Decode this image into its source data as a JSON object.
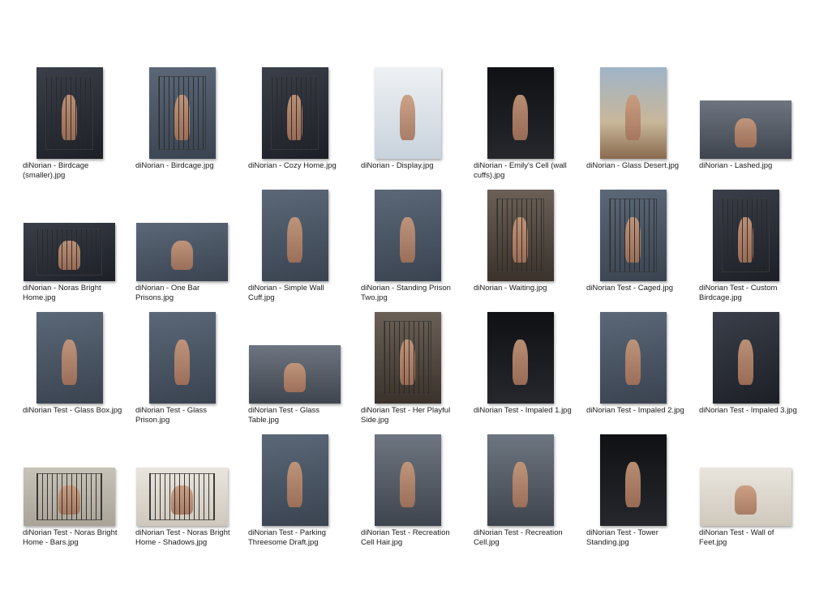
{
  "files": [
    {
      "name": "diNorian - Birdcage (smaller).jpg",
      "shape": "tall",
      "tone": "dark",
      "bars": true
    },
    {
      "name": "diNorian - Birdcage.jpg",
      "shape": "tall",
      "tone": "slate",
      "bars": true
    },
    {
      "name": "diNorian - Cozy Home.jpg",
      "shape": "tall",
      "tone": "dark",
      "bars": true
    },
    {
      "name": "diNorian - Display.jpg",
      "shape": "tall",
      "tone": "light",
      "bars": false
    },
    {
      "name": "diNorian - Emily's Cell (wall cuffs).jpg",
      "shape": "tall",
      "tone": "black",
      "bars": false
    },
    {
      "name": "diNorian - Glass Desert.jpg",
      "shape": "tall",
      "tone": "sky",
      "bars": false
    },
    {
      "name": "diNorian - Lashed.jpg",
      "shape": "wide",
      "tone": "grey",
      "bars": false
    },
    {
      "name": "diNorian - Noras Bright Home.jpg",
      "shape": "wide",
      "tone": "dark",
      "bars": true
    },
    {
      "name": "diNorian - One Bar Prisons.jpg",
      "shape": "wide",
      "tone": "slate",
      "bars": false
    },
    {
      "name": "diNorian - Simple Wall Cuff.jpg",
      "shape": "tall",
      "tone": "slate",
      "bars": false
    },
    {
      "name": "diNorian - Standing Prison Two.jpg",
      "shape": "tall",
      "tone": "slate",
      "bars": false
    },
    {
      "name": "diNorian - Waiting.jpg",
      "shape": "tall",
      "tone": "stone",
      "bars": true
    },
    {
      "name": "diNorian Test - Caged.jpg",
      "shape": "tall",
      "tone": "slate",
      "bars": true
    },
    {
      "name": "diNorian Test - Custom Birdcage.jpg",
      "shape": "tall",
      "tone": "dark",
      "bars": true
    },
    {
      "name": "diNorian Test - Glass Box.jpg",
      "shape": "tall",
      "tone": "slate",
      "bars": false
    },
    {
      "name": "diNorian Test - Glass Prison.jpg",
      "shape": "tall",
      "tone": "slate",
      "bars": false
    },
    {
      "name": "diNorian Test - Glass Table.jpg",
      "shape": "wide",
      "tone": "grey",
      "bars": false
    },
    {
      "name": "diNorian Test - Her Playful Side.jpg",
      "shape": "tall",
      "tone": "stone",
      "bars": true
    },
    {
      "name": "diNorian Test - Impaled 1.jpg",
      "shape": "tall",
      "tone": "black",
      "bars": false
    },
    {
      "name": "diNorian Test - Impaled 2.jpg",
      "shape": "tall",
      "tone": "slate",
      "bars": false
    },
    {
      "name": "diNorian Test - Impaled 3.jpg",
      "shape": "tall",
      "tone": "dark",
      "bars": false
    },
    {
      "name": "diNorian Test - Noras Bright Home - Bars.jpg",
      "shape": "wide",
      "tone": "beige",
      "bars": true
    },
    {
      "name": "diNorian Test - Noras Bright Home - Shadows.jpg",
      "shape": "wide",
      "tone": "pale",
      "bars": true
    },
    {
      "name": "diNorian Test - Parking Threesome Draft.jpg",
      "shape": "tall",
      "tone": "slate",
      "bars": false
    },
    {
      "name": "diNorian Test - Recreation Cell Hair.jpg",
      "shape": "tall",
      "tone": "grey",
      "bars": false
    },
    {
      "name": "diNorian Test - Recreation Cell.jpg",
      "shape": "tall",
      "tone": "grey",
      "bars": false
    },
    {
      "name": "diNorian Test - Tower Standing.jpg",
      "shape": "tall",
      "tone": "black",
      "bars": false
    },
    {
      "name": "diNorian Test - Wall of Feet.jpg",
      "shape": "wide",
      "tone": "pale",
      "bars": false
    }
  ]
}
